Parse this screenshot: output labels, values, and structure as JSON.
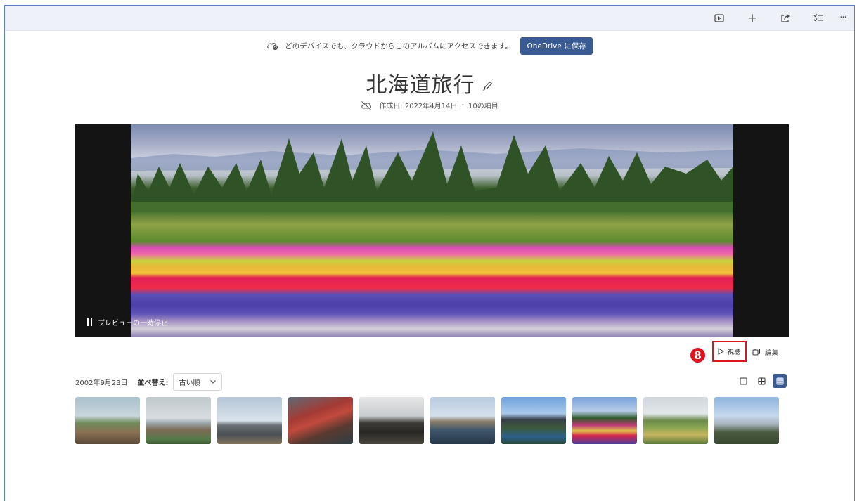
{
  "topbar": {
    "buttons": [
      {
        "name": "slideshow-icon"
      },
      {
        "name": "add-icon",
        "glyph": "+"
      },
      {
        "name": "share-icon"
      },
      {
        "name": "select-icon"
      },
      {
        "name": "more-icon",
        "glyph": "···"
      }
    ]
  },
  "banner": {
    "text": "どのデバイスでも、クラウドからこのアルバムにアクセスできます。",
    "button_label": "OneDrive に保存"
  },
  "album": {
    "title": "北海道旅行",
    "meta_created": "作成日: 2022年4月14日",
    "meta_separator": "-",
    "meta_count": "10の項目"
  },
  "hero": {
    "pause_label": "プレビューの一時停止"
  },
  "annotation": {
    "marker": "8"
  },
  "actions": {
    "play_label": "視聴",
    "edit_label": "編集"
  },
  "filter": {
    "date": "2002年9月23日",
    "sort_label": "並べ替え:",
    "sort_value": "古い順"
  },
  "thumbnails": [
    {
      "name": "thumb-1"
    },
    {
      "name": "thumb-2"
    },
    {
      "name": "thumb-3"
    },
    {
      "name": "thumb-4"
    },
    {
      "name": "thumb-5"
    },
    {
      "name": "thumb-6"
    },
    {
      "name": "thumb-7"
    },
    {
      "name": "thumb-8"
    },
    {
      "name": "thumb-9"
    },
    {
      "name": "thumb-10"
    }
  ],
  "colors": {
    "accent": "#3a5a93",
    "marker_red": "#e0141e",
    "frame_border": "#5b7fc2"
  }
}
